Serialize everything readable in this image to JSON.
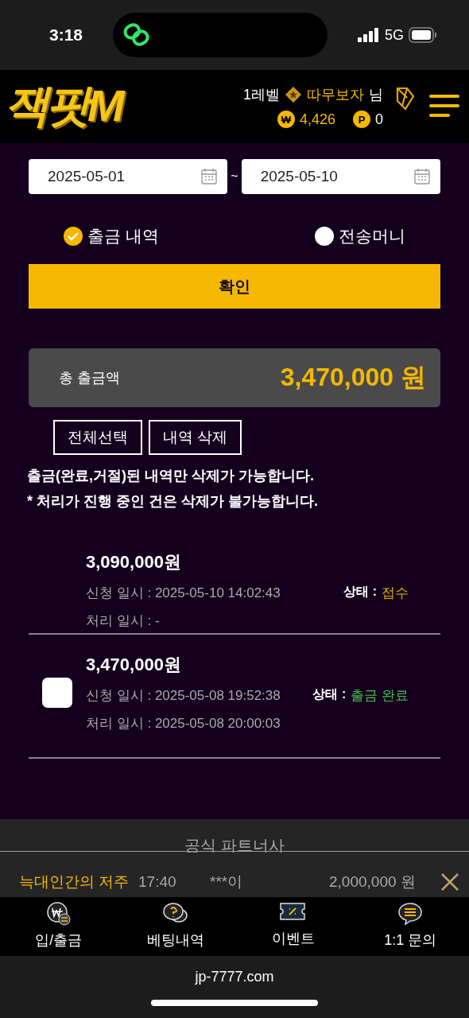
{
  "status_bar": {
    "time": "3:18",
    "network": "5G"
  },
  "header": {
    "logo": "잭팟M",
    "level": "1레벨",
    "user": "따무보자",
    "suffix": "님",
    "money_symbol": "₩",
    "money": "4,426",
    "points_symbol": "P",
    "points": "0"
  },
  "filter": {
    "start_date": "2025-05-01",
    "separator": "~",
    "end_date": "2025-05-10"
  },
  "options": [
    {
      "label": "출금 내역",
      "selected": true
    },
    {
      "label": "전송머니",
      "selected": false
    }
  ],
  "confirm_button": "확인",
  "total": {
    "label": "총 출금액",
    "amount": "3,470,000 원"
  },
  "actions": [
    "전체선택",
    "내역 삭제"
  ],
  "notes": [
    "출금(완료,거절)된 내역만 삭제가 가능합니다.",
    "* 처리가 진행 중인 건은 삭제가 불가능합니다."
  ],
  "records": [
    {
      "amount": "3,090,000원",
      "requested": "신청 일시 : 2025-05-10 14:02:43",
      "processed": "처리 일시 : -",
      "status_label": "상태 :",
      "status": "접수",
      "kind": "received"
    },
    {
      "checked": false,
      "amount": "3,470,000원",
      "requested": "신청 일시 : 2025-05-08 19:52:38",
      "processed": "처리 일시 : 2025-05-08 20:00:03",
      "status_label": "상태 :",
      "status": "출금 완료",
      "kind": "done"
    }
  ],
  "partners": {
    "title": "공식 파트너사"
  },
  "ticker": {
    "game": "늑대인간의 저주",
    "time": "17:40",
    "user": "***이",
    "amount": "2,000,000 원"
  },
  "tab_bar": [
    {
      "label": "입/출금"
    },
    {
      "label": "베팅내역"
    },
    {
      "label": "이벤트"
    },
    {
      "label": "1:1 문의"
    }
  ],
  "browser": {
    "url": "jp-7777.com"
  }
}
